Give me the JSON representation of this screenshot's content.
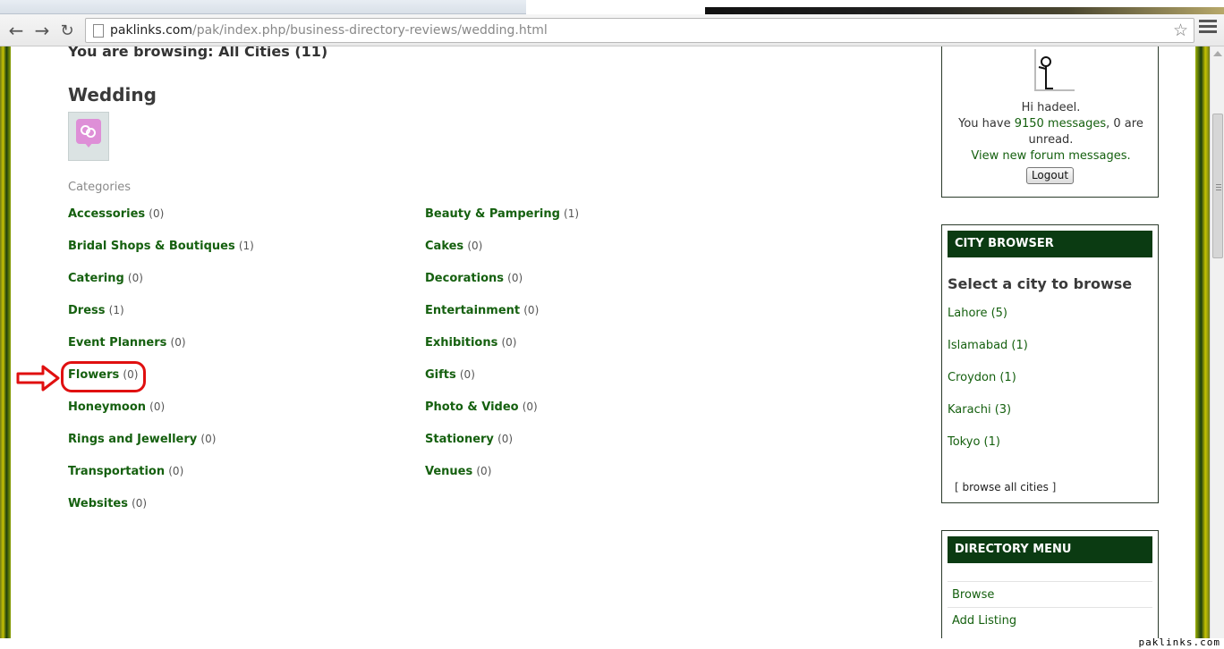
{
  "browser": {
    "url_host": "paklinks.com",
    "url_path": "/pak/index.php/business-directory-reviews/wedding.html"
  },
  "main": {
    "browsing_text": "You are browsing: All Cities (11)",
    "category_title": "Wedding",
    "categories_label": "Categories",
    "left_column": [
      {
        "name": "Accessories",
        "count": "(0)"
      },
      {
        "name": "Bridal Shops & Boutiques",
        "count": "(1)"
      },
      {
        "name": "Catering",
        "count": "(0)"
      },
      {
        "name": "Dress",
        "count": "(1)"
      },
      {
        "name": "Event Planners",
        "count": "(0)"
      },
      {
        "name": "Flowers",
        "count": "(0)"
      },
      {
        "name": "Honeymoon",
        "count": "(0)"
      },
      {
        "name": "Rings and Jewellery",
        "count": "(0)"
      },
      {
        "name": "Transportation",
        "count": "(0)"
      },
      {
        "name": "Websites",
        "count": "(0)"
      }
    ],
    "right_column": [
      {
        "name": "Beauty & Pampering",
        "count": "(1)"
      },
      {
        "name": "Cakes",
        "count": "(0)"
      },
      {
        "name": "Decorations",
        "count": "(0)"
      },
      {
        "name": "Entertainment",
        "count": "(0)"
      },
      {
        "name": "Exhibitions",
        "count": "(0)"
      },
      {
        "name": "Gifts",
        "count": "(0)"
      },
      {
        "name": "Photo & Video",
        "count": "(0)"
      },
      {
        "name": "Stationery",
        "count": "(0)"
      },
      {
        "name": "Venues",
        "count": "(0)"
      }
    ]
  },
  "sidebar": {
    "user": {
      "greeting": "Hi hadeel.",
      "you_have": "You have ",
      "messages_link": "9150 messages",
      "unread_text": ", 0 are unread.",
      "forum_link": "View new forum messages.",
      "logout_label": "Logout"
    },
    "city_browser": {
      "header": "CITY BROWSER",
      "heading": "Select a city to browse",
      "cities": [
        "Lahore (5)",
        "Islamabad (1)",
        "Croydon (1)",
        "Karachi (3)",
        "Tokyo (1)"
      ],
      "browse_all_open": "[ ",
      "browse_all_link": "browse all cities",
      "browse_all_close": " ]"
    },
    "directory_menu": {
      "header": "DIRECTORY MENU",
      "items": [
        "Browse",
        "Add Listing"
      ]
    }
  },
  "watermark": "paklinks.com",
  "colors": {
    "link_green": "#15600f",
    "header_green": "#0b3b12",
    "highlight_red": "#e01010"
  }
}
